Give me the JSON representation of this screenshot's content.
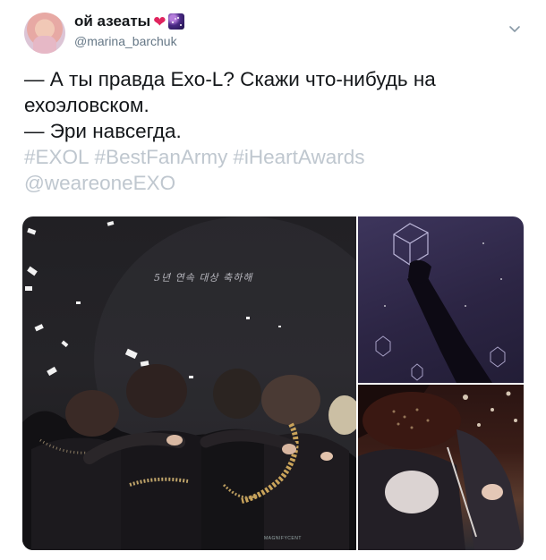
{
  "user": {
    "display_name": "ой азеаты",
    "heart_emoji": "❤",
    "handle": "@marina_barchuk"
  },
  "tweet": {
    "lines": [
      "— А ты правда Exo-L? Скажи что-нибудь на",
      "ехоэловском.",
      "— Эри навсегда."
    ],
    "hashtags": [
      "#EXOL",
      "#BestFanArmy",
      "#iHeartAwards"
    ],
    "mention": "@weareoneEXO"
  },
  "media": {
    "main_caption": "5년 연속 대상 축하해",
    "watermark": "MAGNIFYCENT"
  },
  "colors": {
    "text": "#14171a",
    "secondary": "#657786",
    "link_faded": "#bfc7cf",
    "heart": "#e0245e"
  }
}
